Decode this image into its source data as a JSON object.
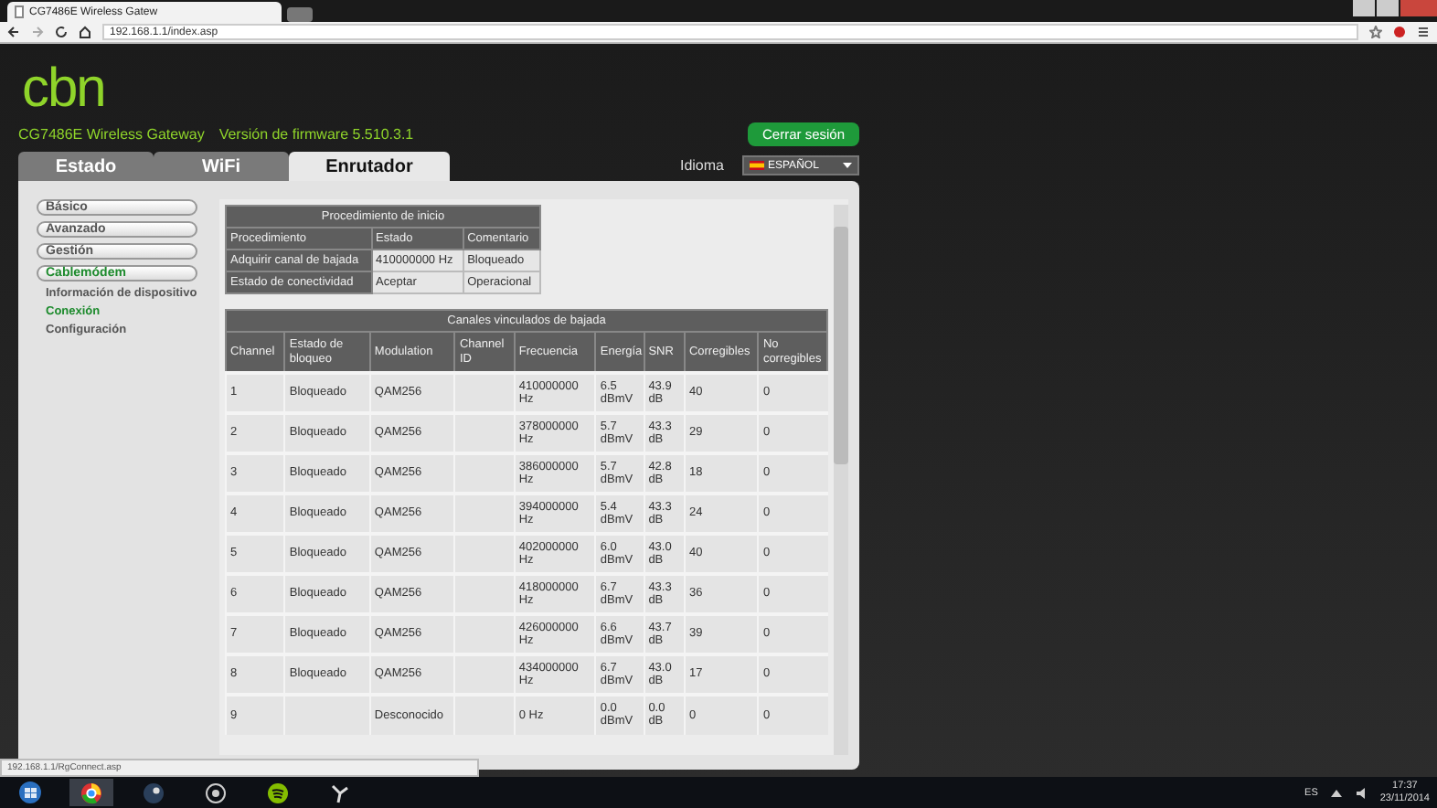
{
  "browser": {
    "tab_title": "CG7486E Wireless Gatew",
    "url": "192.168.1.1/index.asp",
    "status_url": "192.168.1.1/RgConnect.asp"
  },
  "header": {
    "logo": "cbn",
    "model": "CG7486E Wireless Gateway",
    "firmware": "Versión de firmware 5.510.3.1",
    "logout": "Cerrar sesión"
  },
  "tabs": [
    {
      "label": "Estado",
      "selected": false
    },
    {
      "label": "WiFi",
      "selected": false
    },
    {
      "label": "Enrutador",
      "selected": true
    }
  ],
  "language": {
    "label": "Idioma",
    "value": "ESPAÑOL"
  },
  "sidebar": {
    "items": [
      {
        "label": "Básico",
        "selected": false
      },
      {
        "label": "Avanzado",
        "selected": false
      },
      {
        "label": "Gestión",
        "selected": false
      },
      {
        "label": "Cablemódem",
        "selected": true,
        "children": [
          {
            "label": "Información de dispositivo",
            "selected": false
          },
          {
            "label": "Conexión",
            "selected": true
          },
          {
            "label": "Configuración",
            "selected": false
          }
        ]
      }
    ]
  },
  "startup_table": {
    "title": "Procedimiento de inicio",
    "columns": [
      "Procedimiento",
      "Estado",
      "Comentario"
    ],
    "rows": [
      [
        "Adquirir canal de bajada",
        "410000000 Hz",
        "Bloqueado"
      ],
      [
        "Estado de conectividad",
        "Aceptar",
        "Operacional"
      ]
    ]
  },
  "downstream_table": {
    "title": "Canales vinculados de bajada",
    "columns": [
      "Channel",
      "Estado de bloqueo",
      "Modulation",
      "Channel ID",
      "Frecuencia",
      "Energía",
      "SNR",
      "Corregibles",
      "No corregibles"
    ],
    "rows": [
      [
        "1",
        "Bloqueado",
        "QAM256",
        "",
        "410000000 Hz",
        "6.5 dBmV",
        "43.9 dB",
        "40",
        "0"
      ],
      [
        "2",
        "Bloqueado",
        "QAM256",
        "",
        "378000000 Hz",
        "5.7 dBmV",
        "43.3 dB",
        "29",
        "0"
      ],
      [
        "3",
        "Bloqueado",
        "QAM256",
        "",
        "386000000 Hz",
        "5.7 dBmV",
        "42.8 dB",
        "18",
        "0"
      ],
      [
        "4",
        "Bloqueado",
        "QAM256",
        "",
        "394000000 Hz",
        "5.4 dBmV",
        "43.3 dB",
        "24",
        "0"
      ],
      [
        "5",
        "Bloqueado",
        "QAM256",
        "",
        "402000000 Hz",
        "6.0 dBmV",
        "43.0 dB",
        "40",
        "0"
      ],
      [
        "6",
        "Bloqueado",
        "QAM256",
        "",
        "418000000 Hz",
        "6.7 dBmV",
        "43.3 dB",
        "36",
        "0"
      ],
      [
        "7",
        "Bloqueado",
        "QAM256",
        "",
        "426000000 Hz",
        "6.6 dBmV",
        "43.7 dB",
        "39",
        "0"
      ],
      [
        "8",
        "Bloqueado",
        "QAM256",
        "",
        "434000000 Hz",
        "6.7 dBmV",
        "43.0 dB",
        "17",
        "0"
      ],
      [
        "9",
        "",
        "Desconocido",
        "",
        "0 Hz",
        "0.0 dBmV",
        "0.0 dB",
        "0",
        "0"
      ]
    ]
  },
  "taskbar": {
    "language": "ES",
    "time": "17:37",
    "date": "23/11/2014"
  }
}
